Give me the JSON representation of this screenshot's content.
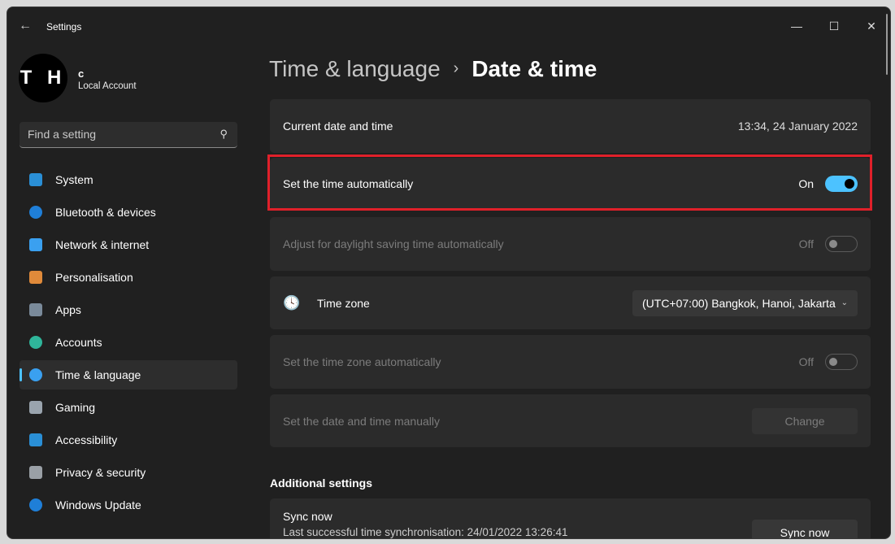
{
  "window": {
    "title": "Settings",
    "minimize": "—",
    "maximize": "☐",
    "close": "✕",
    "back": "←"
  },
  "user": {
    "initials": "T H",
    "name": "c",
    "account_type": "Local Account"
  },
  "search": {
    "placeholder": "Find a setting"
  },
  "sidebar": {
    "items": [
      {
        "label": "System",
        "icon": "monitor-icon",
        "color": "#2a8fd6"
      },
      {
        "label": "Bluetooth & devices",
        "icon": "bluetooth-icon",
        "color": "#1f7fd8"
      },
      {
        "label": "Network & internet",
        "icon": "wifi-icon",
        "color": "#3aa0f0"
      },
      {
        "label": "Personalisation",
        "icon": "brush-icon",
        "color": "#e08a3a"
      },
      {
        "label": "Apps",
        "icon": "apps-icon",
        "color": "#7a8a9a"
      },
      {
        "label": "Accounts",
        "icon": "person-icon",
        "color": "#2fb59a"
      },
      {
        "label": "Time & language",
        "icon": "clock-globe-icon",
        "color": "#3aa0f0",
        "active": true
      },
      {
        "label": "Gaming",
        "icon": "gamepad-icon",
        "color": "#9aa4ae"
      },
      {
        "label": "Accessibility",
        "icon": "accessibility-icon",
        "color": "#2a8fd6"
      },
      {
        "label": "Privacy & security",
        "icon": "shield-icon",
        "color": "#9aa0a6"
      },
      {
        "label": "Windows Update",
        "icon": "update-icon",
        "color": "#1f7fd8"
      }
    ]
  },
  "breadcrumb": {
    "parent": "Time & language",
    "separator": "›",
    "current": "Date & time"
  },
  "settings": {
    "current": {
      "label": "Current date and time",
      "value": "13:34, 24 January 2022"
    },
    "auto_time": {
      "label": "Set the time automatically",
      "state": "On"
    },
    "daylight": {
      "label": "Adjust for daylight saving time automatically",
      "state": "Off"
    },
    "timezone": {
      "label": "Time zone",
      "value": "(UTC+07:00) Bangkok, Hanoi, Jakarta"
    },
    "auto_tz": {
      "label": "Set the time zone automatically",
      "state": "Off"
    },
    "manual": {
      "label": "Set the date and time manually",
      "button": "Change"
    }
  },
  "additional": {
    "heading": "Additional settings",
    "sync": {
      "label": "Sync now",
      "detail": "Last successful time synchronisation: 24/01/2022 13:26:41",
      "button": "Sync now"
    }
  },
  "colors": {
    "accent": "#4cc2ff",
    "highlight": "#e0202a"
  }
}
